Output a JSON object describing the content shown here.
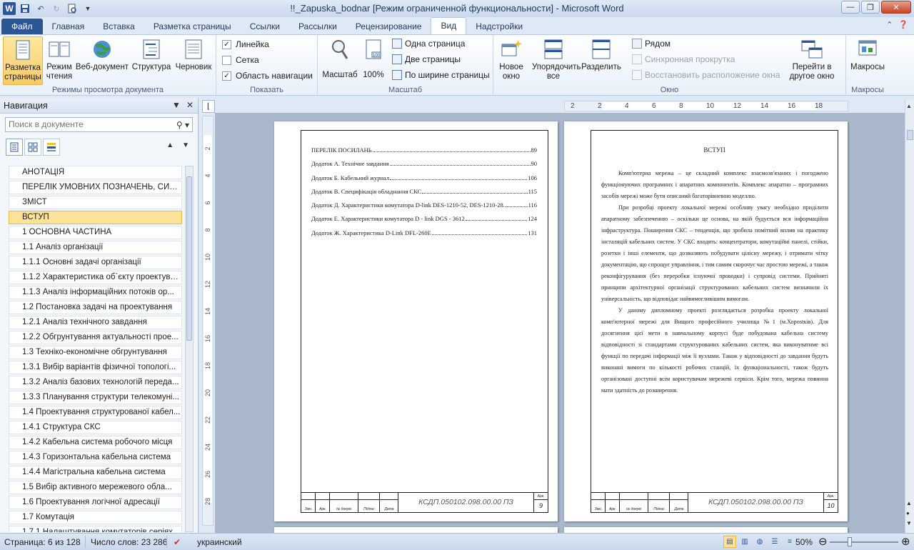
{
  "window": {
    "title": "!!_Zapuska_bodnar [Режим ограниченной функциональности]  -  Microsoft Word",
    "logo": "W"
  },
  "tabs": [
    "Файл",
    "Главная",
    "Вставка",
    "Разметка страницы",
    "Ссылки",
    "Рассылки",
    "Рецензирование",
    "Вид",
    "Надстройки"
  ],
  "ribbon": {
    "views": {
      "group": "Режимы просмотра документа",
      "print_layout": "Разметка страницы",
      "reading": "Режим чтения",
      "web": "Веб-документ",
      "outline": "Структура",
      "draft": "Черновик"
    },
    "show": {
      "group": "Показать",
      "ruler": "Линейка",
      "grid": "Сетка",
      "nav_pane": "Область навигации",
      "ruler_checked": true,
      "grid_checked": false,
      "nav_checked": true
    },
    "zoom": {
      "group": "Масштаб",
      "zoom": "Масштаб",
      "hundred": "100%",
      "one_page": "Одна страница",
      "two_pages": "Две страницы",
      "page_width": "По ширине страницы"
    },
    "window": {
      "group": "Окно",
      "new_window": "Новое окно",
      "arrange_all": "Упорядочить все",
      "split": "Разделить",
      "side_by_side": "Рядом",
      "sync_scroll": "Синхронная прокрутка",
      "reset_pos": "Восстановить расположение окна",
      "switch_windows": "Перейти в другое окно"
    },
    "macros": {
      "group": "Макросы",
      "macros": "Макросы"
    }
  },
  "nav": {
    "title": "Навигация",
    "search_placeholder": "Поиск в документе",
    "headings": [
      "АНОТАЦІЯ",
      "ПЕРЕЛІК УМОВНИХ ПОЗНАЧЕНЬ, СИМВ...",
      "ЗМІСТ",
      "ВСТУП",
      "1 ОСНОВНА ЧАСТИНА",
      "1.1 Аналіз організації",
      "1.1.1 Основні задачі організації",
      "1.1.2 Характеристика об`єкту проектува...",
      "1.1.3 Аналіз інформаційних потоків ор...",
      "1.2 Постановка задачі на проектування",
      "1.2.1 Аналіз технічного завдання",
      "1.2.2 Обгрунтування актуальності прое...",
      "1.3 Техніко-економічне обгрунтування",
      "1.3.1 Вибір варіантів фізичної топологі...",
      "1.3.2 Аналіз базових технологій переда...",
      "1.3.3 Планування структури телекомуні...",
      "1.4 Проектування структурованої кабел...",
      "1.4.1 Структура СКС",
      "1.4.2 Кабельна система робочого місця",
      "1.4.3 Горизонтальна кабельна система",
      "1.4.4 Магістральна кабельна система",
      "1.5 Вибір активного мережевого обла...",
      "1.6 Проектування логічної адресації",
      "1.7 Комутація",
      "1.7.1 Налаштування комутаторів серіях..."
    ],
    "active_index": 3
  },
  "ruler": {
    "h_ticks": [
      "2",
      "2",
      "4",
      "6",
      "8",
      "10",
      "12",
      "14",
      "16",
      "18"
    ],
    "v_ticks": [
      "2",
      "4",
      "6",
      "8",
      "10",
      "12",
      "14",
      "16",
      "18",
      "20",
      "22",
      "24",
      "26",
      "28"
    ]
  },
  "doc": {
    "left_page": {
      "toc": [
        {
          "t": "ПЕРЕЛІК ПОСИЛАНЬ",
          "p": "89"
        },
        {
          "t": "Додаток А. Технічне завдання",
          "p": "90"
        },
        {
          "t": "Додаток Б. Кабельний журнал",
          "p": "106"
        },
        {
          "t": "Додаток В. Специфікація обладнання СКС",
          "p": "115"
        },
        {
          "t": "Додаток Д. Характеристики комутатора D-link DES-1210-52, DES-1210-28.",
          "p": "116"
        },
        {
          "t": "Додаток Е. Характеристики комутатора D - link DGS - 3612",
          "p": "124"
        },
        {
          "t": "Додаток Ж. Характеристика D-Link DFL-260E",
          "p": "131"
        }
      ],
      "code": "КСДП.050102.098.00.00 ПЗ",
      "page_label": "Арк.",
      "page_num": "9"
    },
    "right_page": {
      "title": "ВСТУП",
      "paragraphs": [
        "Комп'ютерна мережа – це складний комплекс взаємозв'язаних і погоджено функціонуючих програмних і апаратних компонентів. Комплекс апаратно – програмних засобів мережі може бути описаний багаторівневою моделлю.",
        "При розробці проекту локальної мережі особливу увагу необхідно приділити апаратному забезпеченню – оскільки це основа, на якій будується вся інформаційна інфраструктура. Поширення СКС – тенденція, що зробила помітний вплив на практику інсталяцій кабельних систем. У СКС входять: концентратори, комутаційні панелі, стійки, розетки і інші елементи, що дозволяють побудувати цілісну мережу, і отримати чітку документацію, що спрощує управління, і тим самим скорочує час простою мережі, а також реконфігурування (без переробки існуючої проводки) і супровід системи. Прийняті принципи архітектурної організації структурованих кабельних систем визначили їх універсальність, що відповідає найвимогливішим вимогам.",
        "У даному дипломному проекті розглядається розробка проекту локальної комп'ютерної мережі для Вищого професійного училища №1 (м.Хорostків). Для досягнення цієї мети в навчальному корпусі буде побудована кабельна систему відповідності зі стандартами структурованих кабельних систем, яка виконуватиме всі функції по передачі інформації між її вузлами. Також у відповідності до завдання будуть виконані вимоги по кількості робочих станцій, їх функціональності, також будуть організовані доступні всім користувачам мережеві сервіси. Крім того, мережа повинна мати здатність до розширення."
      ],
      "code": "КСДП.050102.098.00.00 ПЗ",
      "page_label": "Арк.",
      "page_num": "10"
    },
    "stamp_labels": [
      "Змн.",
      "Арк.",
      "№ докум.",
      "Підпис",
      "Дата"
    ]
  },
  "status": {
    "page": "Страница: 6 из 128",
    "words": "Число слов: 23 286",
    "lang": "украинский",
    "zoom": "50%"
  }
}
